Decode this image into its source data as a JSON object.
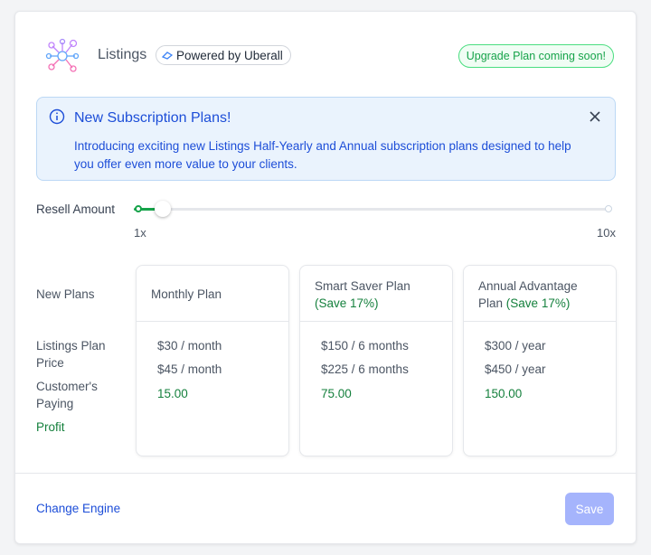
{
  "header": {
    "title": "Listings",
    "powered_by": "Powered by Uberall",
    "upgrade_badge": "Upgrade Plan coming soon!",
    "logo_icon": "listings-network-icon"
  },
  "alert": {
    "title": "New Subscription Plans!",
    "body": "Introducing exciting new Listings Half-Yearly and Annual subscription plans designed to help you offer even more value to your clients.",
    "icon": "info-icon",
    "close_icon": "close-icon"
  },
  "resell": {
    "label": "Resell Amount",
    "min_label": "1x",
    "max_label": "10x",
    "value_fraction": 0.06
  },
  "rows": {
    "new_plans": "New Plans",
    "price": "Listings Plan Price",
    "paying": "Customer's Paying",
    "profit": "Profit"
  },
  "plans": [
    {
      "name": "Monthly Plan",
      "save": "",
      "price": "$30 / month",
      "paying": "$45 / month",
      "profit": "15.00"
    },
    {
      "name": "Smart Saver Plan",
      "save": "(Save 17%)",
      "price": "$150 / 6 months",
      "paying": "$225 / 6 months",
      "profit": "75.00"
    },
    {
      "name": "Annual Advantage Plan",
      "save": "(Save 17%)",
      "price": "$300 / year",
      "paying": "$450 / year",
      "profit": "150.00"
    }
  ],
  "footer": {
    "change_engine": "Change Engine",
    "save": "Save"
  },
  "colors": {
    "accent_blue": "#1d4ed8",
    "accent_green": "#15803d",
    "alert_bg": "#eaf3fd",
    "save_button_disabled": "#a5b4fc"
  }
}
